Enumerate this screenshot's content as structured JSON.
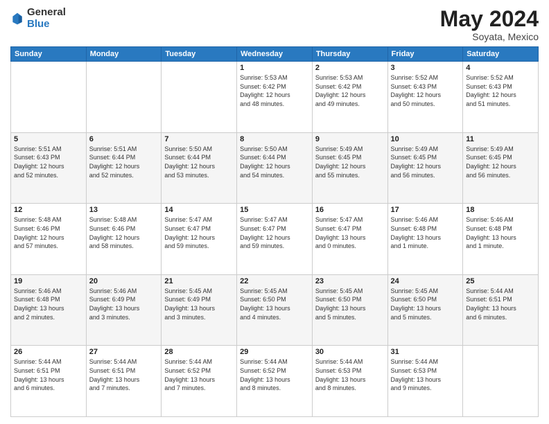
{
  "header": {
    "logo_general": "General",
    "logo_blue": "Blue",
    "title": "May 2024",
    "location": "Soyata, Mexico"
  },
  "days_of_week": [
    "Sunday",
    "Monday",
    "Tuesday",
    "Wednesday",
    "Thursday",
    "Friday",
    "Saturday"
  ],
  "weeks": [
    [
      {
        "day": "",
        "content": ""
      },
      {
        "day": "",
        "content": ""
      },
      {
        "day": "",
        "content": ""
      },
      {
        "day": "1",
        "content": "Sunrise: 5:53 AM\nSunset: 6:42 PM\nDaylight: 12 hours\nand 48 minutes."
      },
      {
        "day": "2",
        "content": "Sunrise: 5:53 AM\nSunset: 6:42 PM\nDaylight: 12 hours\nand 49 minutes."
      },
      {
        "day": "3",
        "content": "Sunrise: 5:52 AM\nSunset: 6:43 PM\nDaylight: 12 hours\nand 50 minutes."
      },
      {
        "day": "4",
        "content": "Sunrise: 5:52 AM\nSunset: 6:43 PM\nDaylight: 12 hours\nand 51 minutes."
      }
    ],
    [
      {
        "day": "5",
        "content": "Sunrise: 5:51 AM\nSunset: 6:43 PM\nDaylight: 12 hours\nand 52 minutes."
      },
      {
        "day": "6",
        "content": "Sunrise: 5:51 AM\nSunset: 6:44 PM\nDaylight: 12 hours\nand 52 minutes."
      },
      {
        "day": "7",
        "content": "Sunrise: 5:50 AM\nSunset: 6:44 PM\nDaylight: 12 hours\nand 53 minutes."
      },
      {
        "day": "8",
        "content": "Sunrise: 5:50 AM\nSunset: 6:44 PM\nDaylight: 12 hours\nand 54 minutes."
      },
      {
        "day": "9",
        "content": "Sunrise: 5:49 AM\nSunset: 6:45 PM\nDaylight: 12 hours\nand 55 minutes."
      },
      {
        "day": "10",
        "content": "Sunrise: 5:49 AM\nSunset: 6:45 PM\nDaylight: 12 hours\nand 56 minutes."
      },
      {
        "day": "11",
        "content": "Sunrise: 5:49 AM\nSunset: 6:45 PM\nDaylight: 12 hours\nand 56 minutes."
      }
    ],
    [
      {
        "day": "12",
        "content": "Sunrise: 5:48 AM\nSunset: 6:46 PM\nDaylight: 12 hours\nand 57 minutes."
      },
      {
        "day": "13",
        "content": "Sunrise: 5:48 AM\nSunset: 6:46 PM\nDaylight: 12 hours\nand 58 minutes."
      },
      {
        "day": "14",
        "content": "Sunrise: 5:47 AM\nSunset: 6:47 PM\nDaylight: 12 hours\nand 59 minutes."
      },
      {
        "day": "15",
        "content": "Sunrise: 5:47 AM\nSunset: 6:47 PM\nDaylight: 12 hours\nand 59 minutes."
      },
      {
        "day": "16",
        "content": "Sunrise: 5:47 AM\nSunset: 6:47 PM\nDaylight: 13 hours\nand 0 minutes."
      },
      {
        "day": "17",
        "content": "Sunrise: 5:46 AM\nSunset: 6:48 PM\nDaylight: 13 hours\nand 1 minute."
      },
      {
        "day": "18",
        "content": "Sunrise: 5:46 AM\nSunset: 6:48 PM\nDaylight: 13 hours\nand 1 minute."
      }
    ],
    [
      {
        "day": "19",
        "content": "Sunrise: 5:46 AM\nSunset: 6:48 PM\nDaylight: 13 hours\nand 2 minutes."
      },
      {
        "day": "20",
        "content": "Sunrise: 5:46 AM\nSunset: 6:49 PM\nDaylight: 13 hours\nand 3 minutes."
      },
      {
        "day": "21",
        "content": "Sunrise: 5:45 AM\nSunset: 6:49 PM\nDaylight: 13 hours\nand 3 minutes."
      },
      {
        "day": "22",
        "content": "Sunrise: 5:45 AM\nSunset: 6:50 PM\nDaylight: 13 hours\nand 4 minutes."
      },
      {
        "day": "23",
        "content": "Sunrise: 5:45 AM\nSunset: 6:50 PM\nDaylight: 13 hours\nand 5 minutes."
      },
      {
        "day": "24",
        "content": "Sunrise: 5:45 AM\nSunset: 6:50 PM\nDaylight: 13 hours\nand 5 minutes."
      },
      {
        "day": "25",
        "content": "Sunrise: 5:44 AM\nSunset: 6:51 PM\nDaylight: 13 hours\nand 6 minutes."
      }
    ],
    [
      {
        "day": "26",
        "content": "Sunrise: 5:44 AM\nSunset: 6:51 PM\nDaylight: 13 hours\nand 6 minutes."
      },
      {
        "day": "27",
        "content": "Sunrise: 5:44 AM\nSunset: 6:51 PM\nDaylight: 13 hours\nand 7 minutes."
      },
      {
        "day": "28",
        "content": "Sunrise: 5:44 AM\nSunset: 6:52 PM\nDaylight: 13 hours\nand 7 minutes."
      },
      {
        "day": "29",
        "content": "Sunrise: 5:44 AM\nSunset: 6:52 PM\nDaylight: 13 hours\nand 8 minutes."
      },
      {
        "day": "30",
        "content": "Sunrise: 5:44 AM\nSunset: 6:53 PM\nDaylight: 13 hours\nand 8 minutes."
      },
      {
        "day": "31",
        "content": "Sunrise: 5:44 AM\nSunset: 6:53 PM\nDaylight: 13 hours\nand 9 minutes."
      },
      {
        "day": "",
        "content": ""
      }
    ]
  ]
}
